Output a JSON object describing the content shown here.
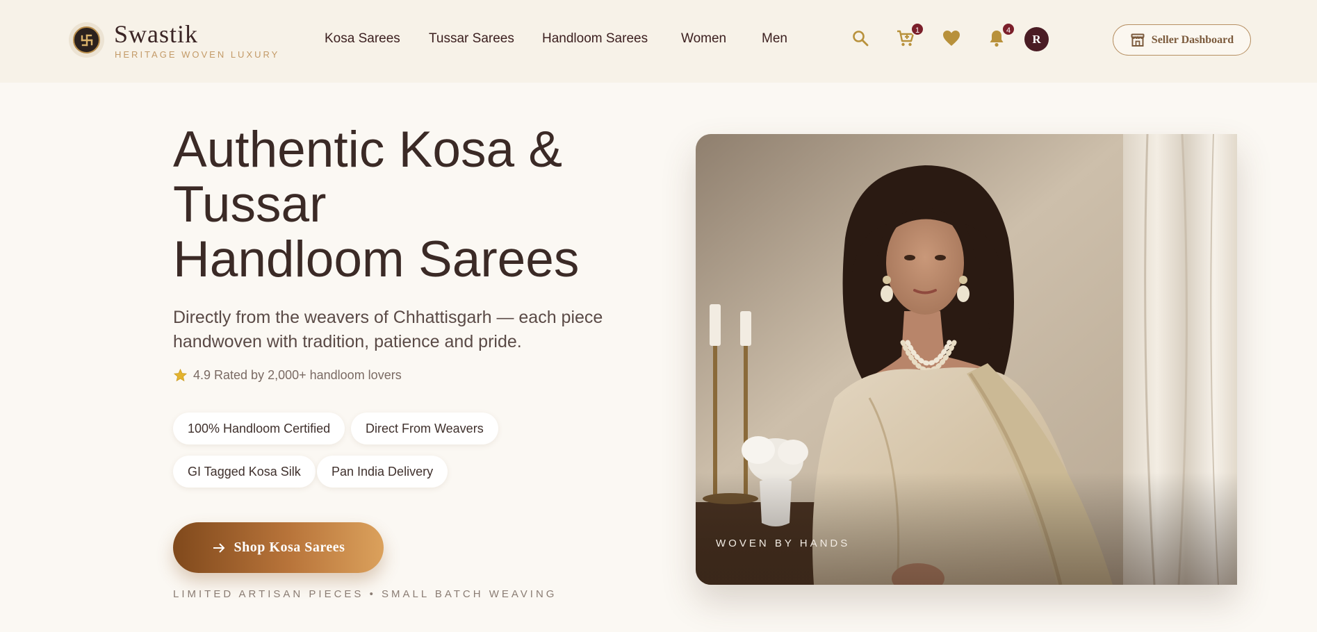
{
  "brand": {
    "name": "Swastik",
    "tagline": "HERITAGE WOVEN LUXURY",
    "logo_icon": "swastika-emblem-icon"
  },
  "nav": {
    "items": [
      {
        "label": "Kosa Sarees"
      },
      {
        "label": "Tussar Sarees"
      },
      {
        "label": "Handloom Sarees"
      },
      {
        "label": "Women"
      },
      {
        "label": "Men"
      }
    ]
  },
  "header_icons": {
    "search_icon": "search-icon",
    "cart_icon": "cart-icon",
    "cart_count": "1",
    "wishlist_icon": "heart-icon",
    "notification_icon": "bell-icon",
    "notification_count": "4",
    "avatar_initial": "R"
  },
  "seller_button": {
    "label": "Seller Dashboard",
    "icon": "store-icon"
  },
  "hero": {
    "title_line1": "Authentic Kosa &",
    "title_line2": "Tussar",
    "title_line3": "Handloom Sarees",
    "subtitle": "Directly from the weavers of Chhattisgarh — each piece handwoven with tradition, patience and pride.",
    "rating": "4.9 Rated by 2,000+ handloom lovers",
    "rating_icon": "star-icon",
    "badges": [
      "100% Handloom Certified",
      "Direct From Weavers",
      "GI Tagged Kosa Silk",
      "Pan India Delivery"
    ],
    "cta_label": "Shop Kosa Sarees",
    "cta_icon": "arrow-right-icon",
    "footnote": "LIMITED ARTISAN PIECES • SMALL BATCH WEAVING",
    "image_caption": "WOVEN BY HANDS"
  },
  "colors": {
    "header_bg": "#f7f2e8",
    "page_bg": "#fbf8f3",
    "gold_icon": "#b8913b",
    "badge_red": "#7b1f2a",
    "cta_start": "#80491c",
    "cta_end": "#dba15c"
  }
}
